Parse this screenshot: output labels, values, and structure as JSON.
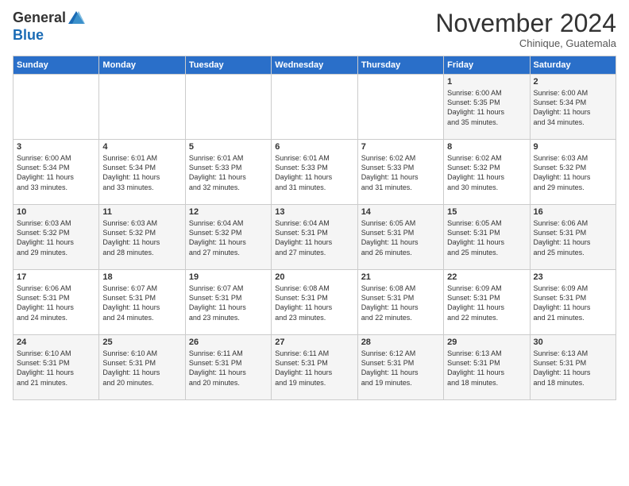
{
  "logo": {
    "general": "General",
    "blue": "Blue"
  },
  "title": "November 2024",
  "location": "Chinique, Guatemala",
  "weekdays": [
    "Sunday",
    "Monday",
    "Tuesday",
    "Wednesday",
    "Thursday",
    "Friday",
    "Saturday"
  ],
  "weeks": [
    [
      {
        "day": "",
        "info": ""
      },
      {
        "day": "",
        "info": ""
      },
      {
        "day": "",
        "info": ""
      },
      {
        "day": "",
        "info": ""
      },
      {
        "day": "",
        "info": ""
      },
      {
        "day": "1",
        "info": "Sunrise: 6:00 AM\nSunset: 5:35 PM\nDaylight: 11 hours\nand 35 minutes."
      },
      {
        "day": "2",
        "info": "Sunrise: 6:00 AM\nSunset: 5:34 PM\nDaylight: 11 hours\nand 34 minutes."
      }
    ],
    [
      {
        "day": "3",
        "info": "Sunrise: 6:00 AM\nSunset: 5:34 PM\nDaylight: 11 hours\nand 33 minutes."
      },
      {
        "day": "4",
        "info": "Sunrise: 6:01 AM\nSunset: 5:34 PM\nDaylight: 11 hours\nand 33 minutes."
      },
      {
        "day": "5",
        "info": "Sunrise: 6:01 AM\nSunset: 5:33 PM\nDaylight: 11 hours\nand 32 minutes."
      },
      {
        "day": "6",
        "info": "Sunrise: 6:01 AM\nSunset: 5:33 PM\nDaylight: 11 hours\nand 31 minutes."
      },
      {
        "day": "7",
        "info": "Sunrise: 6:02 AM\nSunset: 5:33 PM\nDaylight: 11 hours\nand 31 minutes."
      },
      {
        "day": "8",
        "info": "Sunrise: 6:02 AM\nSunset: 5:32 PM\nDaylight: 11 hours\nand 30 minutes."
      },
      {
        "day": "9",
        "info": "Sunrise: 6:03 AM\nSunset: 5:32 PM\nDaylight: 11 hours\nand 29 minutes."
      }
    ],
    [
      {
        "day": "10",
        "info": "Sunrise: 6:03 AM\nSunset: 5:32 PM\nDaylight: 11 hours\nand 29 minutes."
      },
      {
        "day": "11",
        "info": "Sunrise: 6:03 AM\nSunset: 5:32 PM\nDaylight: 11 hours\nand 28 minutes."
      },
      {
        "day": "12",
        "info": "Sunrise: 6:04 AM\nSunset: 5:32 PM\nDaylight: 11 hours\nand 27 minutes."
      },
      {
        "day": "13",
        "info": "Sunrise: 6:04 AM\nSunset: 5:31 PM\nDaylight: 11 hours\nand 27 minutes."
      },
      {
        "day": "14",
        "info": "Sunrise: 6:05 AM\nSunset: 5:31 PM\nDaylight: 11 hours\nand 26 minutes."
      },
      {
        "day": "15",
        "info": "Sunrise: 6:05 AM\nSunset: 5:31 PM\nDaylight: 11 hours\nand 25 minutes."
      },
      {
        "day": "16",
        "info": "Sunrise: 6:06 AM\nSunset: 5:31 PM\nDaylight: 11 hours\nand 25 minutes."
      }
    ],
    [
      {
        "day": "17",
        "info": "Sunrise: 6:06 AM\nSunset: 5:31 PM\nDaylight: 11 hours\nand 24 minutes."
      },
      {
        "day": "18",
        "info": "Sunrise: 6:07 AM\nSunset: 5:31 PM\nDaylight: 11 hours\nand 24 minutes."
      },
      {
        "day": "19",
        "info": "Sunrise: 6:07 AM\nSunset: 5:31 PM\nDaylight: 11 hours\nand 23 minutes."
      },
      {
        "day": "20",
        "info": "Sunrise: 6:08 AM\nSunset: 5:31 PM\nDaylight: 11 hours\nand 23 minutes."
      },
      {
        "day": "21",
        "info": "Sunrise: 6:08 AM\nSunset: 5:31 PM\nDaylight: 11 hours\nand 22 minutes."
      },
      {
        "day": "22",
        "info": "Sunrise: 6:09 AM\nSunset: 5:31 PM\nDaylight: 11 hours\nand 22 minutes."
      },
      {
        "day": "23",
        "info": "Sunrise: 6:09 AM\nSunset: 5:31 PM\nDaylight: 11 hours\nand 21 minutes."
      }
    ],
    [
      {
        "day": "24",
        "info": "Sunrise: 6:10 AM\nSunset: 5:31 PM\nDaylight: 11 hours\nand 21 minutes."
      },
      {
        "day": "25",
        "info": "Sunrise: 6:10 AM\nSunset: 5:31 PM\nDaylight: 11 hours\nand 20 minutes."
      },
      {
        "day": "26",
        "info": "Sunrise: 6:11 AM\nSunset: 5:31 PM\nDaylight: 11 hours\nand 20 minutes."
      },
      {
        "day": "27",
        "info": "Sunrise: 6:11 AM\nSunset: 5:31 PM\nDaylight: 11 hours\nand 19 minutes."
      },
      {
        "day": "28",
        "info": "Sunrise: 6:12 AM\nSunset: 5:31 PM\nDaylight: 11 hours\nand 19 minutes."
      },
      {
        "day": "29",
        "info": "Sunrise: 6:13 AM\nSunset: 5:31 PM\nDaylight: 11 hours\nand 18 minutes."
      },
      {
        "day": "30",
        "info": "Sunrise: 6:13 AM\nSunset: 5:31 PM\nDaylight: 11 hours\nand 18 minutes."
      }
    ]
  ]
}
